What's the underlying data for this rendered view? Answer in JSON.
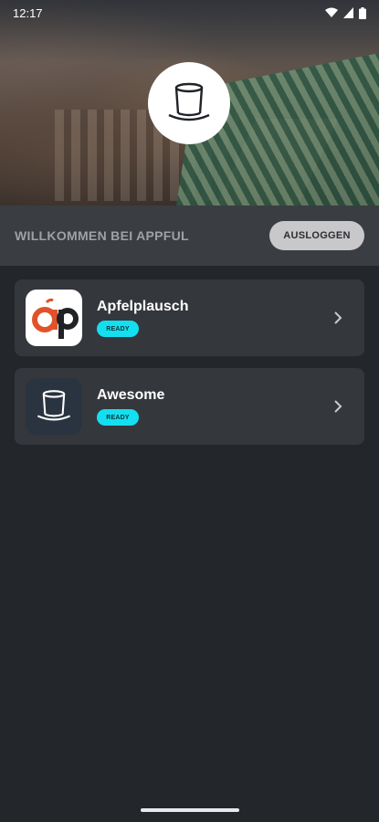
{
  "status_bar": {
    "time": "12:17",
    "icons": [
      "wifi-icon",
      "signal-icon",
      "battery-icon"
    ]
  },
  "header": {
    "logo_icon": "top-hat-icon",
    "welcome_text": "WILLKOMMEN BEI APPFUL",
    "logout_label": "AUSLOGGEN"
  },
  "apps": [
    {
      "name": "Apfelplausch",
      "status": "READY",
      "icon": "apfelplausch-logo-icon"
    },
    {
      "name": "Awesome",
      "status": "READY",
      "icon": "top-hat-icon"
    }
  ],
  "colors": {
    "background": "#23262a",
    "welcome_bar": "#3a3d42",
    "card": "#34373c",
    "badge": "#14dff0",
    "logout_button": "#c8c8ca",
    "brand_orange": "#e0532a"
  }
}
